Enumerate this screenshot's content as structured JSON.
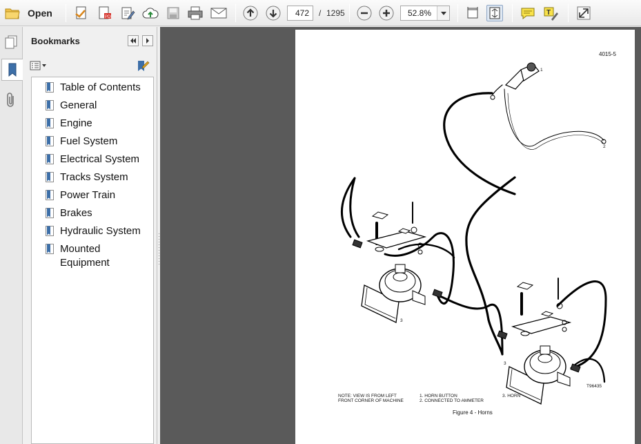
{
  "toolbar": {
    "open_label": "Open",
    "page_current": "472",
    "page_separator": "/",
    "page_total": "1295",
    "zoom_value": "52.8%"
  },
  "sidebar": {
    "title": "Bookmarks",
    "bookmarks": [
      {
        "label": "Table of Contents"
      },
      {
        "label": "General"
      },
      {
        "label": "Engine"
      },
      {
        "label": "Fuel System"
      },
      {
        "label": "Electrical System"
      },
      {
        "label": "Tracks System"
      },
      {
        "label": "Power Train"
      },
      {
        "label": "Brakes"
      },
      {
        "label": "Hydraulic System"
      },
      {
        "label": "Mounted Equipment"
      }
    ]
  },
  "document": {
    "page_code": "4015-5",
    "note_line1": "NOTE:  VIEW IS FROM LEFT",
    "note_line2": "FRONT CORNER OF MACHINE",
    "legend_1": "1.   HORN BUTTON",
    "legend_2": "2.   CONNECTED TO AMMETER",
    "legend_3": "3.   HORN",
    "figure_caption": "Figure 4 - Horns",
    "drawing_number": "T96435",
    "callout_1": "1",
    "callout_2": "2",
    "callout_3": "3"
  },
  "colors": {
    "accent_blue": "#2c6fb7",
    "toolbar_bg": "#f4f4f4",
    "doc_bg": "#5a5a5a",
    "bookmark_icon": "#3d6fa8"
  },
  "icons": [
    "folder-icon",
    "create-pdf-icon",
    "edit-pdf-icon",
    "sign-icon",
    "upload-icon",
    "save-icon",
    "print-icon",
    "email-icon",
    "arrow-up-icon",
    "arrow-down-icon",
    "zoom-out-icon",
    "zoom-in-icon",
    "chevron-down-icon",
    "fit-page-icon",
    "fit-width-icon",
    "comment-icon",
    "highlight-icon",
    "expand-icon",
    "pages-icon",
    "bookmark-icon",
    "attachment-icon",
    "options-icon",
    "bookmark-tool-icon",
    "collapse-left-icon",
    "collapse-right-icon"
  ]
}
